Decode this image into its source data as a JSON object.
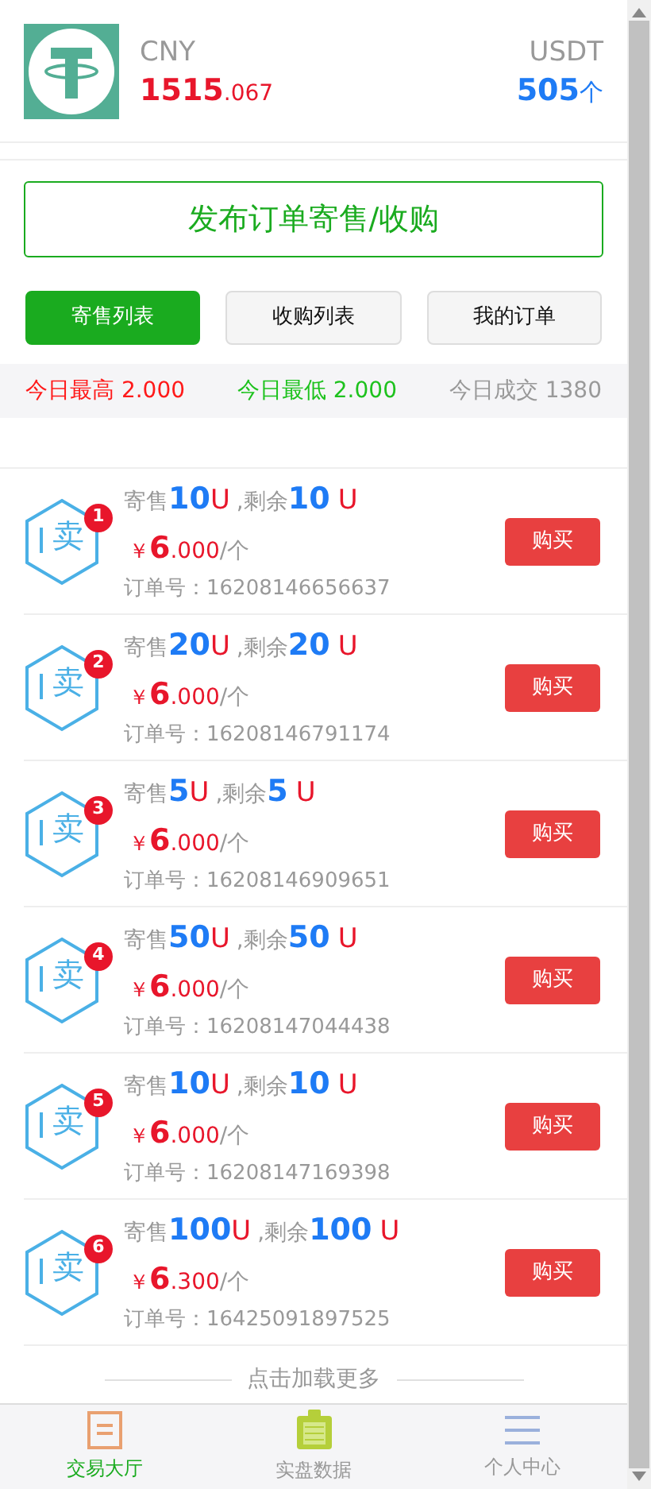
{
  "header": {
    "currency": "CNY",
    "balance_int": "1515",
    "balance_dec": ".067",
    "token": "USDT",
    "token_amount": "505",
    "token_unit": "个"
  },
  "publish_button": "发布订单寄售/收购",
  "tabs": [
    {
      "label": "寄售列表",
      "selected": true
    },
    {
      "label": "收购列表",
      "selected": false
    },
    {
      "label": "我的订单",
      "selected": false
    }
  ],
  "stats": [
    {
      "kind": "high",
      "text": "今日最高 2.000"
    },
    {
      "kind": "low",
      "text": "今日最低 2.000"
    },
    {
      "kind": "volume",
      "text": "今日成交 1380"
    }
  ],
  "orders": [
    {
      "badge": "1",
      "mark": "卖",
      "sell_label": "寄售",
      "sell_amount": "10",
      "sell_unit": "U",
      "remain_label": ",剩余",
      "remain_amount": "10",
      "remain_unit": "U",
      "currency_sign": "￥",
      "price_int": "6",
      "price_dec": ".000",
      "price_unit": "/个",
      "order_no": "订单号：16208146656637",
      "button": "购买"
    },
    {
      "badge": "2",
      "mark": "卖",
      "sell_label": "寄售",
      "sell_amount": "20",
      "sell_unit": "U",
      "remain_label": ",剩余",
      "remain_amount": "20",
      "remain_unit": "U",
      "currency_sign": "￥",
      "price_int": "6",
      "price_dec": ".000",
      "price_unit": "/个",
      "order_no": "订单号：16208146791174",
      "button": "购买"
    },
    {
      "badge": "3",
      "mark": "卖",
      "sell_label": "寄售",
      "sell_amount": "5",
      "sell_unit": "U",
      "remain_label": ",剩余",
      "remain_amount": "5",
      "remain_unit": "U",
      "currency_sign": "￥",
      "price_int": "6",
      "price_dec": ".000",
      "price_unit": "/个",
      "order_no": "订单号：16208146909651",
      "button": "购买"
    },
    {
      "badge": "4",
      "mark": "卖",
      "sell_label": "寄售",
      "sell_amount": "50",
      "sell_unit": "U",
      "remain_label": ",剩余",
      "remain_amount": "50",
      "remain_unit": "U",
      "currency_sign": "￥",
      "price_int": "6",
      "price_dec": ".000",
      "price_unit": "/个",
      "order_no": "订单号：16208147044438",
      "button": "购买"
    },
    {
      "badge": "5",
      "mark": "卖",
      "sell_label": "寄售",
      "sell_amount": "10",
      "sell_unit": "U",
      "remain_label": ",剩余",
      "remain_amount": "10",
      "remain_unit": "U",
      "currency_sign": "￥",
      "price_int": "6",
      "price_dec": ".000",
      "price_unit": "/个",
      "order_no": "订单号：16208147169398",
      "button": "购买"
    },
    {
      "badge": "6",
      "mark": "卖",
      "sell_label": "寄售",
      "sell_amount": "100",
      "sell_unit": "U",
      "remain_label": ",剩余",
      "remain_amount": "100",
      "remain_unit": "U",
      "currency_sign": "￥",
      "price_int": "6",
      "price_dec": ".300",
      "price_unit": "/个",
      "order_no": "订单号：16425091897525",
      "button": "购买"
    }
  ],
  "load_more": "点击加载更多",
  "nav": [
    {
      "kind": "list",
      "label": "交易大厅",
      "selected": true
    },
    {
      "kind": "clipboard",
      "label": "实盘数据",
      "selected": false
    },
    {
      "kind": "menu",
      "label": "个人中心",
      "selected": false
    }
  ]
}
